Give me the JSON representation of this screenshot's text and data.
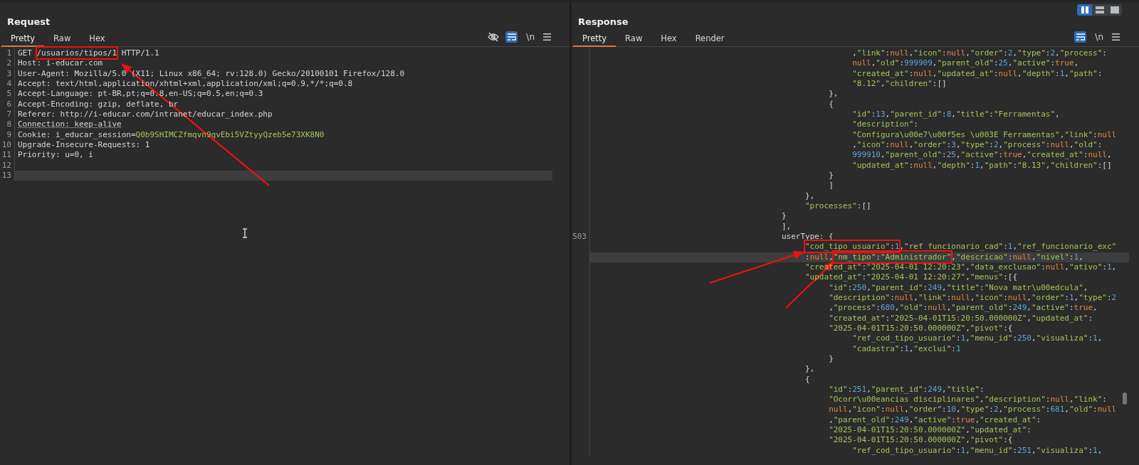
{
  "layout_buttons": [
    {
      "selected": true
    },
    {
      "selected": false
    },
    {
      "selected": false
    }
  ],
  "request": {
    "title": "Request",
    "wrap_on": true,
    "newline_toggle": "\\n",
    "tabs": [
      {
        "label": "Pretty",
        "selected": true
      },
      {
        "label": "Raw",
        "selected": false
      },
      {
        "label": "Hex",
        "selected": false
      }
    ],
    "lines": [
      {
        "number": "1",
        "highlighted": false,
        "parts": [
          {
            "text": "GET ",
            "kind": "plain"
          },
          {
            "text": "/usuarios/tipos/1",
            "kind": "boxed"
          },
          {
            "text": " HTTP/1.1",
            "kind": "plain"
          }
        ]
      },
      {
        "number": "2",
        "highlighted": false,
        "text": "Host: i-educar.com"
      },
      {
        "number": "3",
        "highlighted": false,
        "text": "User-Agent: Mozilla/5.0 (X11; Linux x86_64; rv:128.0) Gecko/20100101 Firefox/128.0"
      },
      {
        "number": "4",
        "highlighted": false,
        "text": "Accept: text/html,application/xhtml+xml,application/xml;q=0.9,*/*;q=0.8"
      },
      {
        "number": "5",
        "highlighted": false,
        "text": "Accept-Language: pt-BR,pt;q=0.8,en-US;q=0.5,en;q=0.3"
      },
      {
        "number": "6",
        "highlighted": false,
        "text": "Accept-Encoding: gzip, deflate, br"
      },
      {
        "number": "7",
        "highlighted": false,
        "text": "Referer: http://i-educar.com/intranet/educar_index.php"
      },
      {
        "number": "8",
        "highlighted": false,
        "parts": [
          {
            "text": "Connection: keep-alive",
            "kind": "flagged"
          }
        ]
      },
      {
        "number": "9",
        "highlighted": false,
        "parts": [
          {
            "text": "Cookie: i_educar_session=",
            "kind": "plain"
          },
          {
            "text": "Q0b9SHIMCZfmqvn9qvEbi5VZtyyQzeb5e73XK8N0",
            "kind": "value"
          }
        ]
      },
      {
        "number": "10",
        "highlighted": false,
        "text": "Upgrade-Insecure-Requests: 1"
      },
      {
        "number": "11",
        "highlighted": false,
        "text": "Priority: u=0, i"
      },
      {
        "number": "12",
        "highlighted": false
      },
      {
        "number": "13",
        "highlighted": true
      }
    ]
  },
  "response": {
    "title": "Response",
    "wrap_on": true,
    "newline_toggle": "\\n",
    "tabs": [
      {
        "label": "Pretty",
        "selected": true
      },
      {
        "label": "Raw",
        "selected": false
      },
      {
        "label": "Hex",
        "selected": false
      },
      {
        "label": "Render",
        "selected": false
      }
    ],
    "lines": [
      {
        "children": [
          {
            "children": [
              {
                "children": [
                  {
                    "highlighted": false,
                    "text": ",\"link\":null,\"icon\":null,\"order\":2,\"type\":2,\"process\":"
                  },
                  {
                    "highlighted": false,
                    "text": "null,\"old\":999909,\"parent_old\":25,\"active\":true,"
                  },
                  {
                    "highlighted": false,
                    "text": "\"created_at\":null,\"updated_at\":null,\"depth\":1,\"path\":"
                  },
                  {
                    "highlighted": false,
                    "text": "\"8.12\",\"children\":[]"
                  }
                ]
              },
              {
                "highlighted": false,
                "text": "},"
              },
              {
                "highlighted": false,
                "text": "{",
                "children": [
                  {
                    "highlighted": false,
                    "text": "\"id\":13,\"parent_id\":8,\"title\":\"Ferramentas\","
                  },
                  {
                    "highlighted": false,
                    "text": "\"description\":"
                  },
                  {
                    "highlighted": false,
                    "text": "\"Configura\\u00e7\\u00f5es \\u003E Ferramentas\",\"link\":null"
                  },
                  {
                    "highlighted": false,
                    "text": ",\"icon\":null,\"order\":3,\"type\":2,\"process\":null,\"old\":"
                  },
                  {
                    "highlighted": false,
                    "text": "999910,\"parent_old\":25,\"active\":true,\"created_at\":null,"
                  },
                  {
                    "highlighted": false,
                    "text": "\"updated_at\":null,\"depth\":1,\"path\":\"8.13\",\"children\":[]"
                  }
                ]
              },
              {
                "highlighted": false,
                "text": "}"
              },
              {
                "highlighted": false,
                "text": "]"
              }
            ]
          },
          {
            "highlighted": false,
            "text": "},"
          },
          {
            "highlighted": false,
            "text": "\"processes\":[]"
          }
        ]
      },
      {
        "highlighted": false,
        "text": "}"
      },
      {
        "highlighted": false,
        "text": "],"
      },
      {
        "number": "503",
        "highlighted": false,
        "text": "userType: {",
        "children": [
          {
            "highlighted": false,
            "parts": [
              {
                "text": "\"cod_tipo_usuario\":1",
                "kind": "boxed"
              },
              {
                "text": ",\"ref_funcionario_cad\":1,\"ref_funcionario_exc\"",
                "kind": "code"
              }
            ]
          },
          {
            "highlighted": true,
            "parts": [
              {
                "text": ":null,",
                "kind": "code"
              },
              {
                "text": "\"nm_tipo\":\"Administrador\"",
                "kind": "boxed"
              },
              {
                "text": ",\"descricao\":null,\"nivel\":1,",
                "kind": "code"
              }
            ]
          },
          {
            "highlighted": false,
            "text": "\"created_at\":\"2025-04-01 12:20:23\",\"data_exclusao\":null,\"ativo\":1,"
          },
          {
            "highlighted": false,
            "text": "\"updated_at\":\"2025-04-01 12:20:27\",\"menus\":[{",
            "children": [
              {
                "highlighted": false,
                "text": "\"id\":250,\"parent_id\":249,\"title\":\"Nova matr\\u00edcula\","
              },
              {
                "highlighted": false,
                "text": "\"description\":null,\"link\":null,\"icon\":null,\"order\":1,\"type\":2"
              },
              {
                "highlighted": false,
                "text": ",\"process\":680,\"old\":null,\"parent_old\":249,\"active\":true,"
              },
              {
                "highlighted": false,
                "text": "\"created_at\":\"2025-04-01T15:20:50.000000Z\",\"updated_at\":"
              },
              {
                "highlighted": false,
                "text": "\"2025-04-01T15:20:50.000000Z\",\"pivot\":{",
                "children": [
                  {
                    "highlighted": false,
                    "text": "\"ref_cod_tipo_usuario\":1,\"menu_id\":250,\"visualiza\":1,"
                  },
                  {
                    "highlighted": false,
                    "text": "\"cadastra\":1,\"exclui\":1"
                  }
                ]
              },
              {
                "highlighted": false,
                "text": "}"
              }
            ]
          },
          {
            "highlighted": false,
            "text": "},"
          },
          {
            "highlighted": false,
            "text": "{",
            "children": [
              {
                "highlighted": false,
                "text": "\"id\":251,\"parent_id\":249,\"title\":"
              },
              {
                "highlighted": false,
                "text": "\"Ocorr\\u00eancias disciplinares\",\"description\":null,\"link\":"
              },
              {
                "highlighted": false,
                "text": "null,\"icon\":null,\"order\":10,\"type\":2,\"process\":681,\"old\":null"
              },
              {
                "highlighted": false,
                "text": ",\"parent_old\":249,\"active\":true,\"created_at\":"
              },
              {
                "highlighted": false,
                "text": "\"2025-04-01T15:20:50.000000Z\",\"updated_at\":"
              },
              {
                "highlighted": false,
                "text": "\"2025-04-01T15:20:50.000000Z\",\"pivot\":{",
                "children": [
                  {
                    "highlighted": false,
                    "text": "\"ref_cod_tipo_usuario\":1,\"menu_id\":251,\"visualiza\":1,"
                  }
                ]
              }
            ]
          }
        ]
      }
    ]
  }
}
